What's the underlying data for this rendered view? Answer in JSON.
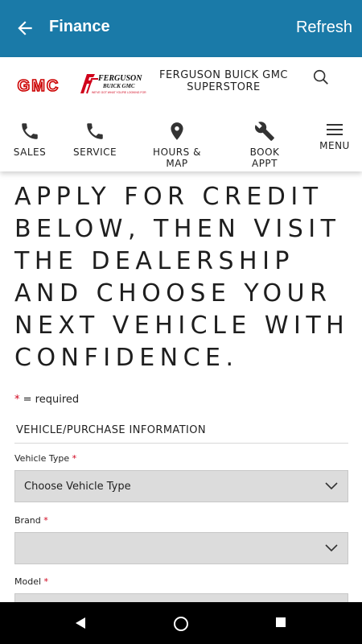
{
  "appbar": {
    "title": "Finance",
    "refresh_label": "Refresh",
    "color": "#1a7aa8"
  },
  "header": {
    "dealer_name_line1": "FERGUSON BUICK GMC",
    "dealer_name_line2": "SUPERSTORE",
    "gmc_logo_text": "GMC",
    "ferguson_logo_text": "FERGUSON",
    "ferguson_logo_subtext": "BUICK GMC",
    "ferguson_logo_tagline": "WE'VE GOT WHAT YOU'RE LOOKING FOR"
  },
  "nav": {
    "items": [
      {
        "label": "SALES",
        "icon": "phone-icon"
      },
      {
        "label": "SERVICE",
        "icon": "phone-icon"
      },
      {
        "label": "HOURS & MAP",
        "icon": "map-pin-icon"
      },
      {
        "label": "BOOK APPT",
        "icon": "wrench-icon"
      },
      {
        "label": "MENU",
        "icon": "hamburger-icon"
      }
    ]
  },
  "content": {
    "hero_lines": [
      "APPLY FOR CREDIT",
      "BELOW, THEN VISIT",
      "THE DEALERSHIP",
      "AND CHOOSE YOUR",
      "NEXT VEHICLE WITH",
      "CONFIDENCE."
    ],
    "required_star": "*",
    "required_text": " = required",
    "section_title": "VEHICLE/PURCHASE INFORMATION",
    "fields": [
      {
        "label": "Vehicle Type",
        "value": "Choose Vehicle Type"
      },
      {
        "label": "Brand",
        "value": ""
      },
      {
        "label": "Model",
        "value": ""
      }
    ],
    "required_color": "#d0021b"
  }
}
